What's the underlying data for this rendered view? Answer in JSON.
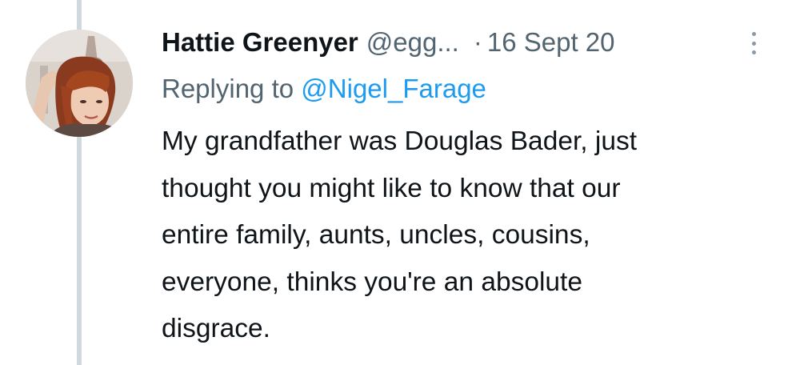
{
  "tweet": {
    "display_name": "Hattie Greenyer",
    "handle": "@egg...",
    "separator": "·",
    "timestamp": "16 Sept 20",
    "replying_prefix": "Replying to",
    "replying_to": "@Nigel_Farage",
    "text_lines": [
      "My grandfather was Douglas Bader, just",
      "thought you might like to know that our",
      "entire family, aunts, uncles, cousins,",
      "everyone, thinks you're an absolute",
      "disgrace."
    ]
  },
  "icons": {
    "more": "more-vertical-icon"
  },
  "colors": {
    "text": "#0f1419",
    "secondary": "#536471",
    "link": "#1d9bf0",
    "thread_line": "#cfd9de"
  }
}
